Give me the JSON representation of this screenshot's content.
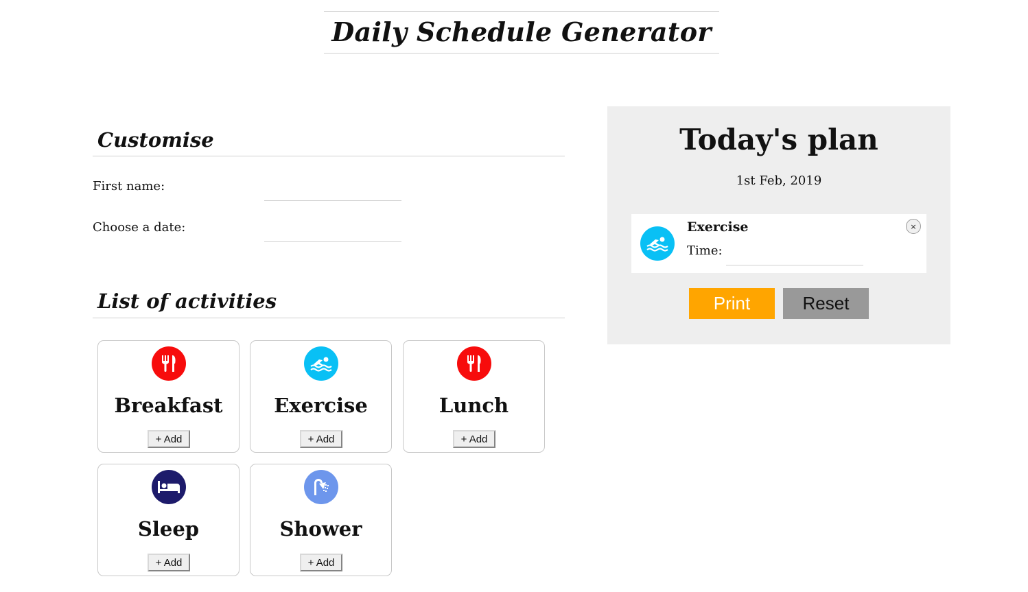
{
  "page": {
    "title": "Daily Schedule Generator"
  },
  "customise": {
    "heading": "Customise",
    "first_name_label": "First name:",
    "first_name_value": "",
    "date_label": "Choose a date:",
    "date_value": ""
  },
  "activities": {
    "heading": "List of activities",
    "add_label": "+ Add",
    "items": [
      {
        "name": "Breakfast",
        "icon": "utensils-icon",
        "color": "#f70c0c"
      },
      {
        "name": "Exercise",
        "icon": "swimmer-icon",
        "color": "#09c0f5"
      },
      {
        "name": "Lunch",
        "icon": "utensils-icon",
        "color": "#f70c0c"
      },
      {
        "name": "Sleep",
        "icon": "bed-icon",
        "color": "#1d1b6b"
      },
      {
        "name": "Shower",
        "icon": "shower-icon",
        "color": "#6d96ec"
      }
    ]
  },
  "plan": {
    "title": "Today's plan",
    "date": "1st Feb, 2019",
    "items": [
      {
        "name": "Exercise",
        "icon": "swimmer-icon",
        "color": "#09c0f5",
        "time_label": "Time:",
        "time_value": "",
        "remove_label": "×"
      }
    ],
    "print_label": "Print",
    "reset_label": "Reset",
    "print_color": "#ffa500",
    "reset_color": "#999999"
  }
}
